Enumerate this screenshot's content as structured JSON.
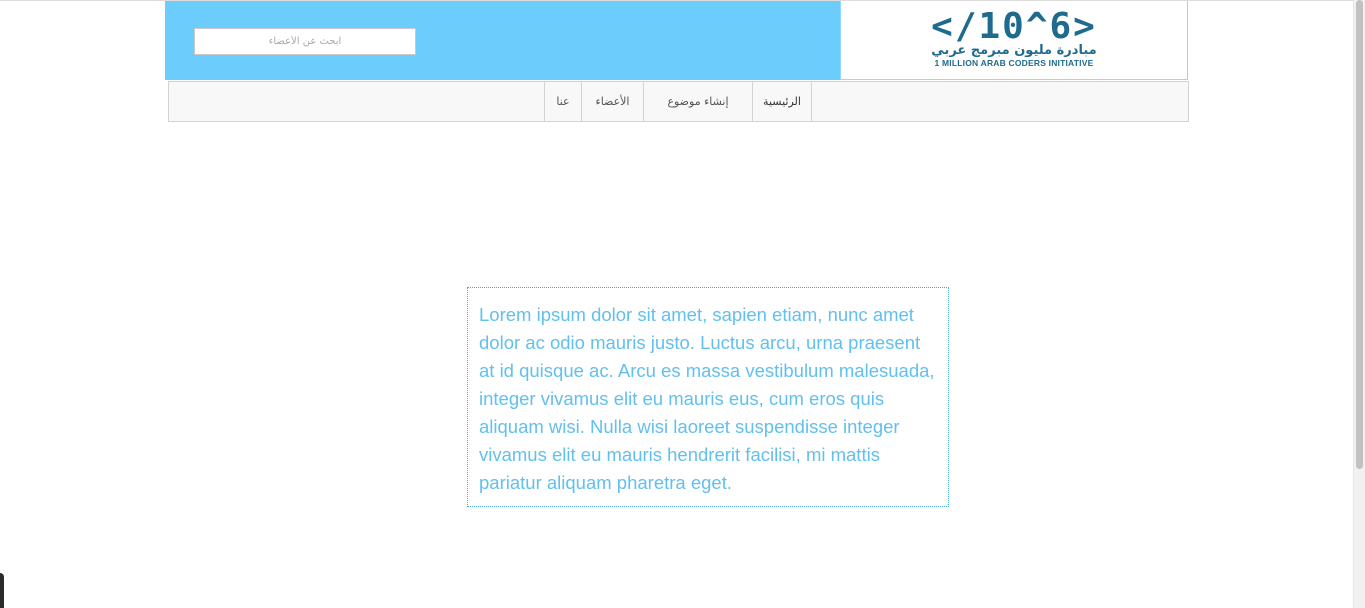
{
  "search": {
    "placeholder": "ابحث عن الأعضاء"
  },
  "logo": {
    "main": "</10^6>",
    "arabic": "مبادرة مليون مبرمج عربي",
    "english": "1 MILLION ARAB CODERS INITIATIVE"
  },
  "nav": {
    "items": [
      {
        "label": "الرئيسية"
      },
      {
        "label": "إنشاء موضوع"
      },
      {
        "label": "الأعضاء"
      },
      {
        "label": "عنا"
      }
    ]
  },
  "content": {
    "text": "Lorem ipsum dolor sit amet, sapien etiam, nunc amet dolor ac odio mauris justo. Luctus arcu, urna praesent at id quisque ac. Arcu es massa vestibulum malesuada, integer vivamus elit eu mauris eus, cum eros quis aliquam wisi. Nulla wisi laoreet suspendisse integer vivamus elit eu mauris hendrerit facilisi, mi mattis pariatur aliquam pharetra eget."
  },
  "colors": {
    "header_bg": "#6ccdfd",
    "logo_text": "#1f6b8e",
    "content_text": "#62c0ee",
    "content_border": "#4aa8dd"
  }
}
